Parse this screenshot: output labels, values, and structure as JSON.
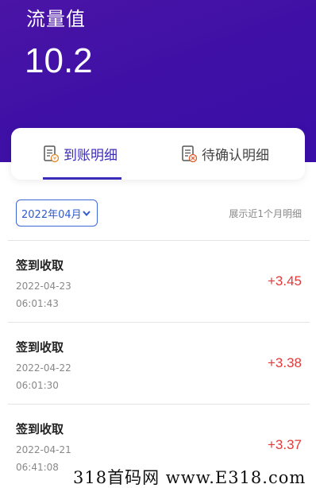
{
  "header": {
    "label": "流量值",
    "value": "10.2"
  },
  "tabs": [
    {
      "label": "到账明细",
      "icon": "receipt-icon",
      "active": true
    },
    {
      "label": "待确认明细",
      "icon": "pending-receipt-icon",
      "active": false
    }
  ],
  "filter": {
    "month": "2022年04月",
    "note": "展示近1个月明细"
  },
  "records": [
    {
      "title": "签到收取",
      "date": "2022-04-23",
      "time": "06:01:43",
      "amount": "+3.45"
    },
    {
      "title": "签到收取",
      "date": "2022-04-22",
      "time": "06:01:30",
      "amount": "+3.38"
    },
    {
      "title": "签到收取",
      "date": "2022-04-21",
      "time": "06:41:08",
      "amount": "+3.37"
    }
  ],
  "watermark": "318首码网 www.E318.com",
  "colors": {
    "accent": "#3a2bb8",
    "hero": "#4212a6",
    "amount": "#e03a3a"
  }
}
